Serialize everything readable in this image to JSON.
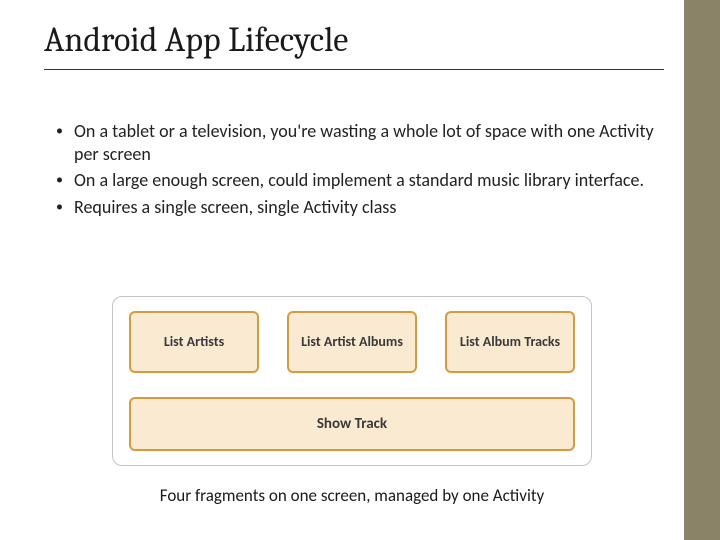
{
  "title": "Android App Lifecycle",
  "bullets": [
    "On a tablet or a television, you're wasting a whole lot of space with one Activity per screen",
    "On a large enough screen, could implement a standard music library interface.",
    "Requires a single screen, single Activity class"
  ],
  "diagram": {
    "fragments_top": [
      "List Artists",
      "List Artist Albums",
      "List Album Tracks"
    ],
    "fragment_bottom": "Show Track",
    "caption": "Four fragments on one screen, managed by one Activity"
  }
}
